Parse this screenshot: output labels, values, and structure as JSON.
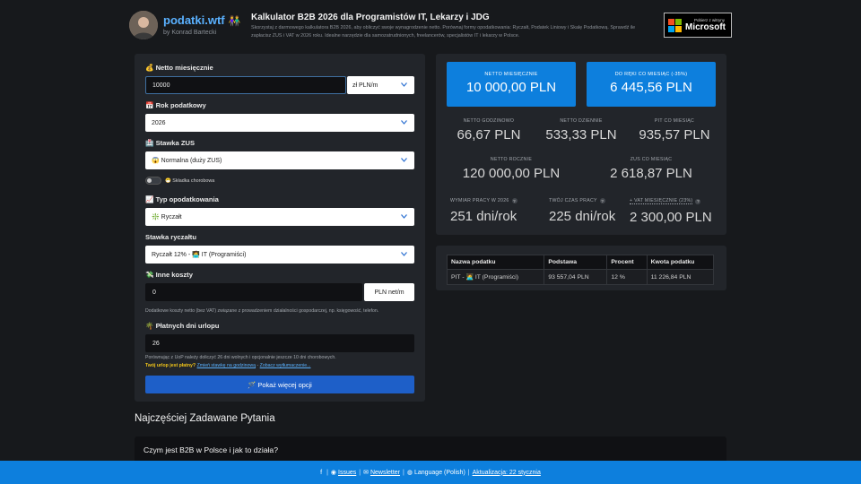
{
  "header": {
    "brand": "podatki.wtf",
    "brand_emoji": "👫",
    "byline": "by Konrad Bartecki",
    "title": "Kalkulator B2B 2026 dla Programistów IT, Lekarzy i JDG",
    "description": "Skorzystaj z darmowego kalkulatora B2B 2026, aby obliczyć swoje wynagrodzenie netto. Porównaj formy opodatkowania: Ryczałt, Podatek Liniowy i Skalę Podatkową. Sprawdź ile zapłacisz ZUS i VAT w 2026 roku. Idealne narzędzie dla samozatrudnionych, freelancerów, specjalistów IT i lekarzy w Polsce.",
    "ms_small": "Pobierz z witryny",
    "ms_big": "Microsoft"
  },
  "form": {
    "netto_label": "💰 Netto miesięcznie",
    "netto_value": "10000",
    "netto_unit": "zł PLN/m",
    "year_label": "📅 Rok podatkowy",
    "year_value": "2026",
    "zus_label": "🏥 Stawka ZUS",
    "zus_value": "😱 Normalna (duży ZUS)",
    "sickness_label": "😷 Składka chorobowa",
    "tax_type_label": "📈 Typ opodatkowania",
    "tax_type_value": "❇️ Ryczałt",
    "rate_label": "Stawka ryczałtu",
    "rate_value": "Ryczałt 12% - 🧑‍💻 IT (Programiści)",
    "costs_label": "💸 Inne koszty",
    "costs_value": "0",
    "costs_unit": "PLN net/m",
    "costs_note": "Dodatkowe koszty netto (bez VAT) związane z prowadzeniem działalności gospodarczej, np. księgowość, telefon.",
    "vacation_label": "🌴 Płatnych dni urlopu",
    "vacation_value": "26",
    "vacation_note": "Porównując z UoP należy doliczyć 26 dni wolnych i opcjonalnie jeszcze 10 dni chorobowych.",
    "vacation_q": "Twój urlop jest płatny?",
    "vacation_link1": "Zmień stawkę na godzinową",
    "vacation_dash": " - ",
    "vacation_link2": "Zobacz wytłumaczenie...",
    "more_button": "🪄 Pokaż więcej opcji"
  },
  "summary": {
    "card1_caption": "NETTO MIESIĘCZNIE",
    "card1_value": "10 000,00 PLN",
    "card2_caption": "DO RĘKI CO MIESIĄC (-35%)",
    "card2_value": "6 445,56 PLN",
    "hourly_caption": "NETTO GODZINOWO",
    "hourly_value": "66,67 PLN",
    "daily_caption": "NETTO DZIENNIE",
    "daily_value": "533,33 PLN",
    "pit_caption": "PIT CO MIESIĄC",
    "pit_value": "935,57 PLN",
    "yearly_caption": "NETTO ROCZNIE",
    "yearly_value": "120 000,00 PLN",
    "zus_caption": "ZUS CO MIESIĄC",
    "zus_value": "2 618,87 PLN",
    "workload_caption": "WYMIAR PRACY W 2026",
    "workload_value": "251 dni/rok",
    "worktime_caption": "TWÓJ CZAS PRACY",
    "worktime_value": "225 dni/rok",
    "vat_caption": "+ VAT MIESIĘCZNIE (23%)",
    "vat_value": "2 300,00 PLN"
  },
  "tax_table": {
    "headers": [
      "Nazwa podatku",
      "Podstawa",
      "Procent",
      "Kwota podatku"
    ],
    "row": [
      "PIT - 🧑‍💻 IT (Programiści)",
      "93 557,04 PLN",
      "12 %",
      "11 226,84 PLN"
    ]
  },
  "faq": {
    "title": "Najczęściej Zadawane Pytania",
    "q1": "Czym jest B2B w Polsce i jak to działa?"
  },
  "footer": {
    "issues": "Issues",
    "newsletter": "Newsletter",
    "language": "Language (Polish)",
    "update": "Aktualizacja: 22 stycznia"
  },
  "colors": {
    "accent": "#0d7fdd",
    "button": "#1e5fc8",
    "panel": "#22252a",
    "background": "#17191c"
  }
}
